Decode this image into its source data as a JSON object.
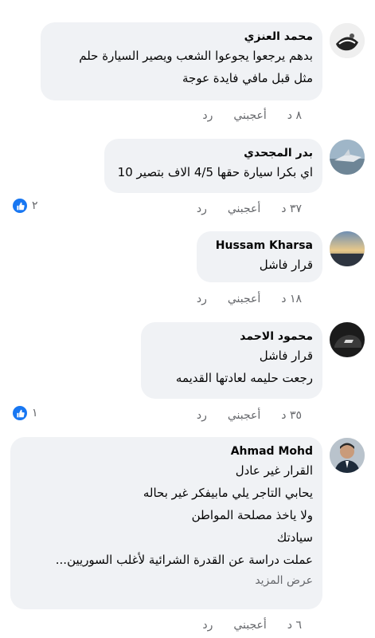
{
  "comments": [
    {
      "author": "محمد العنزي",
      "lines": [
        "بدهم يرجعوا يجوعوا الشعب ويصير السيارة حلم",
        "مثل قبل مافي فايدة عوجة"
      ],
      "time": "٨ د",
      "like": "أعجبني",
      "reply": "رد"
    },
    {
      "author": "بدر المجحدي",
      "lines": [
        "اي بكرا سيارة حقها 4/5 الاف بتصير 10"
      ],
      "time": "٣٧ د",
      "like": "أعجبني",
      "reply": "رد",
      "reaction_count": "٢"
    },
    {
      "author": "Hussam Kharsa",
      "lines": [
        "قرار فاشل"
      ],
      "time": "١٨ د",
      "like": "أعجبني",
      "reply": "رد"
    },
    {
      "author": "محمود الاحمد",
      "lines": [
        "قرار فاشل",
        "رجعت حليمه لعادتها القديمه"
      ],
      "time": "٣٥ د",
      "like": "أعجبني",
      "reply": "رد",
      "reaction_count": "١"
    },
    {
      "author": "Ahmad Mohd",
      "lines": [
        "القرار غير عادل",
        "يحابي التاجر يلي مابيفكر غير بحاله",
        "ولا ياخذ مصلحة المواطن",
        "سيادتك",
        "عملت دراسة عن القدرة الشرائية لأغلب السوريين..."
      ],
      "see_more": "عرض المزيد",
      "time": "٦ د",
      "like": "أعجبني",
      "reply": "رد"
    }
  ],
  "colors": {
    "bubble": "#f0f2f5",
    "meta_text": "#65676b",
    "like_blue": "#1877f2"
  },
  "icons": {
    "like_reaction": "thumbs-up-icon"
  }
}
